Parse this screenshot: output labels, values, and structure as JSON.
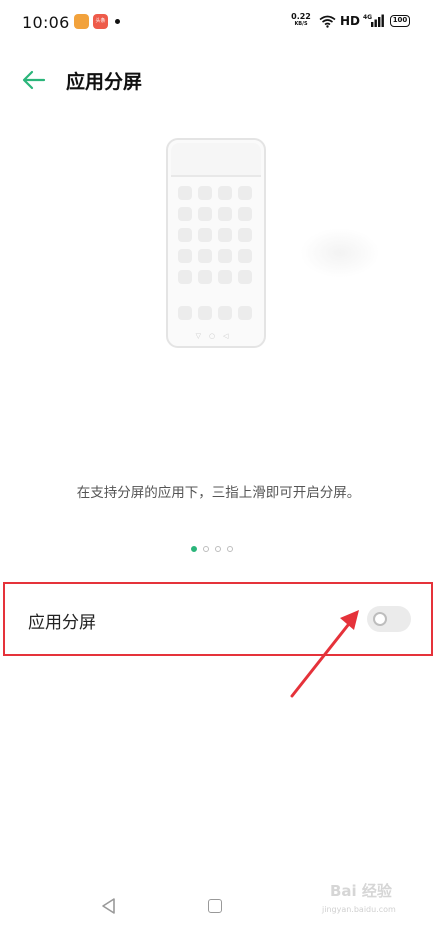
{
  "status_bar": {
    "time": "10:06",
    "app_icon_b_text": "头条",
    "net_speed_value": "0.22",
    "net_speed_unit": "KB/S",
    "network_type": "HD",
    "signal_label": "4G",
    "battery_level": "100"
  },
  "header": {
    "title": "应用分屏"
  },
  "illustration": {
    "icon_names": [
      "phone-outline-icon",
      "app-grid-icon"
    ]
  },
  "description": "在支持分屏的应用下，三指上滑即可开启分屏。",
  "pager": {
    "count": 4,
    "active_index": 0
  },
  "setting": {
    "label": "应用分屏",
    "toggle_state": "off"
  },
  "watermark": {
    "text": "Bai 经验",
    "subtext": "jingyan.baidu.com"
  },
  "colors": {
    "accent": "#2bb57a",
    "highlight_border": "#e5323a",
    "arrow": "#e5323a"
  }
}
